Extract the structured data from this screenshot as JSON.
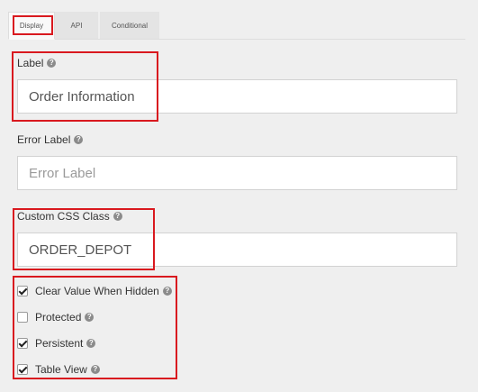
{
  "tabs": [
    {
      "label": "Display"
    },
    {
      "label": "API"
    },
    {
      "label": "Conditional"
    }
  ],
  "fields": {
    "label": {
      "label": "Label",
      "value": "Order Information"
    },
    "error_label": {
      "label": "Error Label",
      "placeholder": "Error Label"
    },
    "custom_css": {
      "label": "Custom CSS Class",
      "value": "ORDER_DEPOT"
    }
  },
  "checkboxes": [
    {
      "label": "Clear Value When Hidden",
      "checked": true
    },
    {
      "label": "Protected",
      "checked": false
    },
    {
      "label": "Persistent",
      "checked": true
    },
    {
      "label": "Table View",
      "checked": true
    }
  ],
  "help_icon_glyph": "?",
  "colors": {
    "highlight": "#d9191f",
    "background": "#efefef",
    "input_border": "#d2d2d2"
  }
}
